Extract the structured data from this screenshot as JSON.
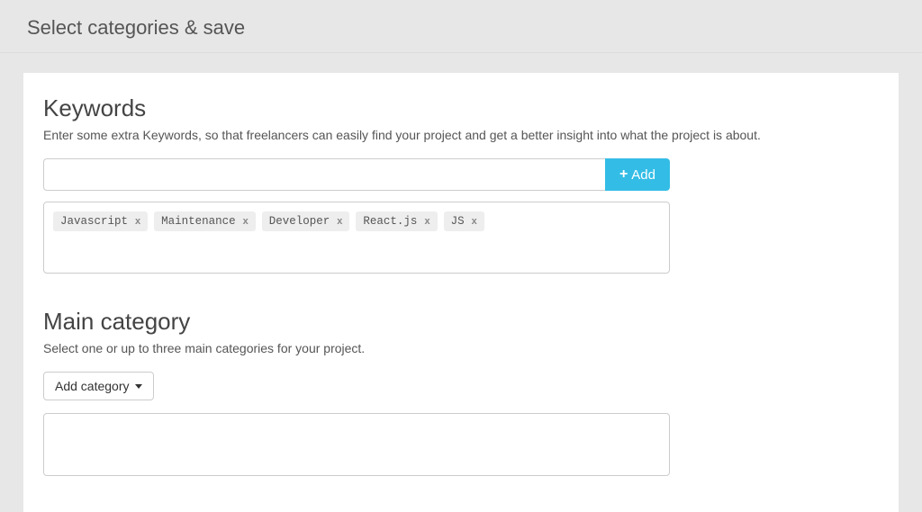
{
  "page": {
    "title": "Select categories & save"
  },
  "keywords": {
    "heading": "Keywords",
    "description": "Enter some extra Keywords, so that freelancers can easily find your project and get a better insight into what the project is about.",
    "input_value": "",
    "add_label": "Add",
    "tags": [
      {
        "label": "Javascript"
      },
      {
        "label": "Maintenance"
      },
      {
        "label": "Developer"
      },
      {
        "label": "React.js"
      },
      {
        "label": "JS"
      }
    ],
    "tag_remove_symbol": "x"
  },
  "main_category": {
    "heading": "Main category",
    "description": "Select one or up to three main categories for your project.",
    "dropdown_label": "Add category"
  }
}
